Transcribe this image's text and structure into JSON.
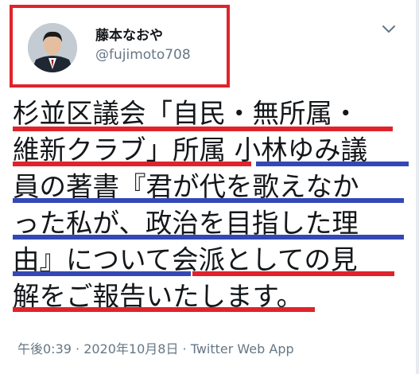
{
  "tweet": {
    "author": {
      "display_name": "藤本なおや",
      "handle": "@fujimoto708"
    },
    "text_lines": [
      "杉並区議会「自民・無所属・",
      "維新クラブ」所属 小林ゆみ議",
      "員の著書『君が代を歌えなか",
      "った私が、政治を目指した理",
      "由』について会派としての見",
      "解をご報告いたします。"
    ],
    "meta_line": "午後0:39 · 2020年10月8日 · Twitter Web App"
  },
  "highlights": {
    "red": "#e0232b",
    "blue": "#3448b5"
  }
}
